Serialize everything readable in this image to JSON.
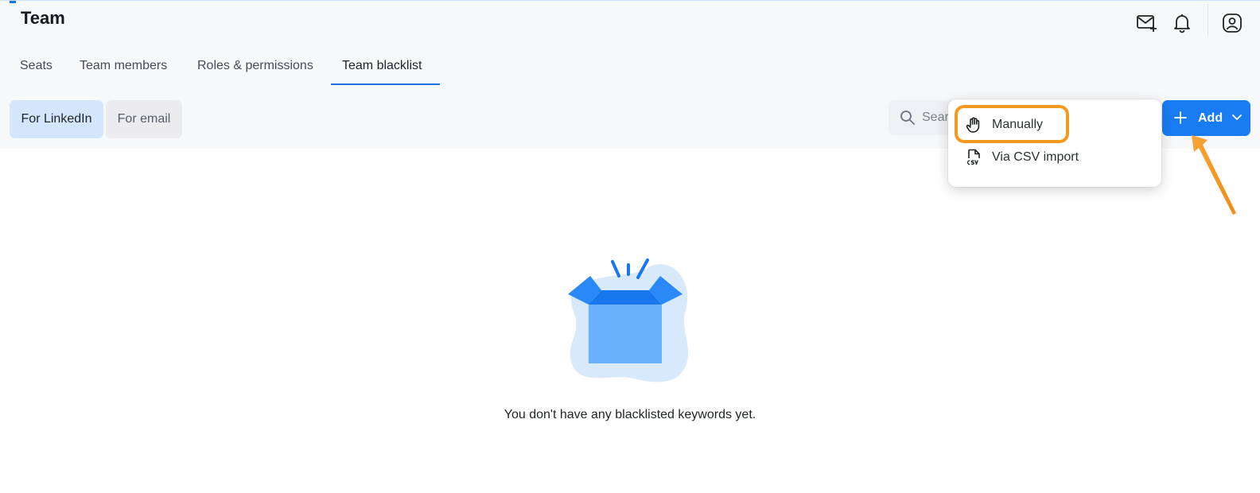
{
  "header": {
    "title": "Team",
    "icons": [
      "mail-plus-icon",
      "bell-icon",
      "user-circle-icon"
    ]
  },
  "tabs": [
    {
      "label": "Seats",
      "active": false
    },
    {
      "label": "Team members",
      "active": false
    },
    {
      "label": "Roles & permissions",
      "active": false
    },
    {
      "label": "Team blacklist",
      "active": true
    }
  ],
  "segments": [
    {
      "label": "For LinkedIn",
      "selected": true
    },
    {
      "label": "For email",
      "selected": false
    }
  ],
  "search": {
    "placeholder": "Search"
  },
  "add_button": {
    "label": "Add"
  },
  "add_menu": {
    "items": [
      {
        "label": "Manually",
        "icon": "hand-icon",
        "highlighted": true
      },
      {
        "label": "Via CSV import",
        "icon": "csv-file-icon"
      }
    ]
  },
  "empty_state": {
    "message": "You don't have any blacklisted keywords yet."
  },
  "colors": {
    "accent": "#1a7cf2",
    "selected_segment_bg": "#d4e6fb",
    "annotation_orange": "#f39a1f"
  }
}
